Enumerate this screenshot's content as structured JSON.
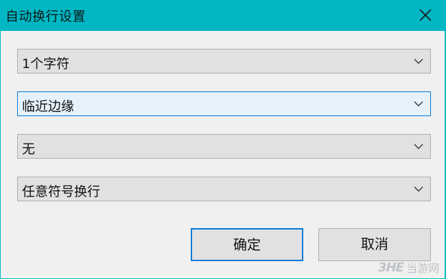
{
  "window": {
    "title": "自动换行设置",
    "accent_color": "#00b7c3"
  },
  "combos": [
    {
      "value": "1个字符",
      "focused": false
    },
    {
      "value": "临近边缘",
      "focused": true
    },
    {
      "value": "无",
      "focused": false
    },
    {
      "value": "任意符号换行",
      "focused": false
    }
  ],
  "buttons": {
    "ok_label": "确定",
    "cancel_label": "取消"
  },
  "watermark": {
    "logo": "3HE",
    "text": "当游网"
  },
  "icons": {
    "close": "close-icon",
    "dropdown": "chevron-down-icon"
  }
}
